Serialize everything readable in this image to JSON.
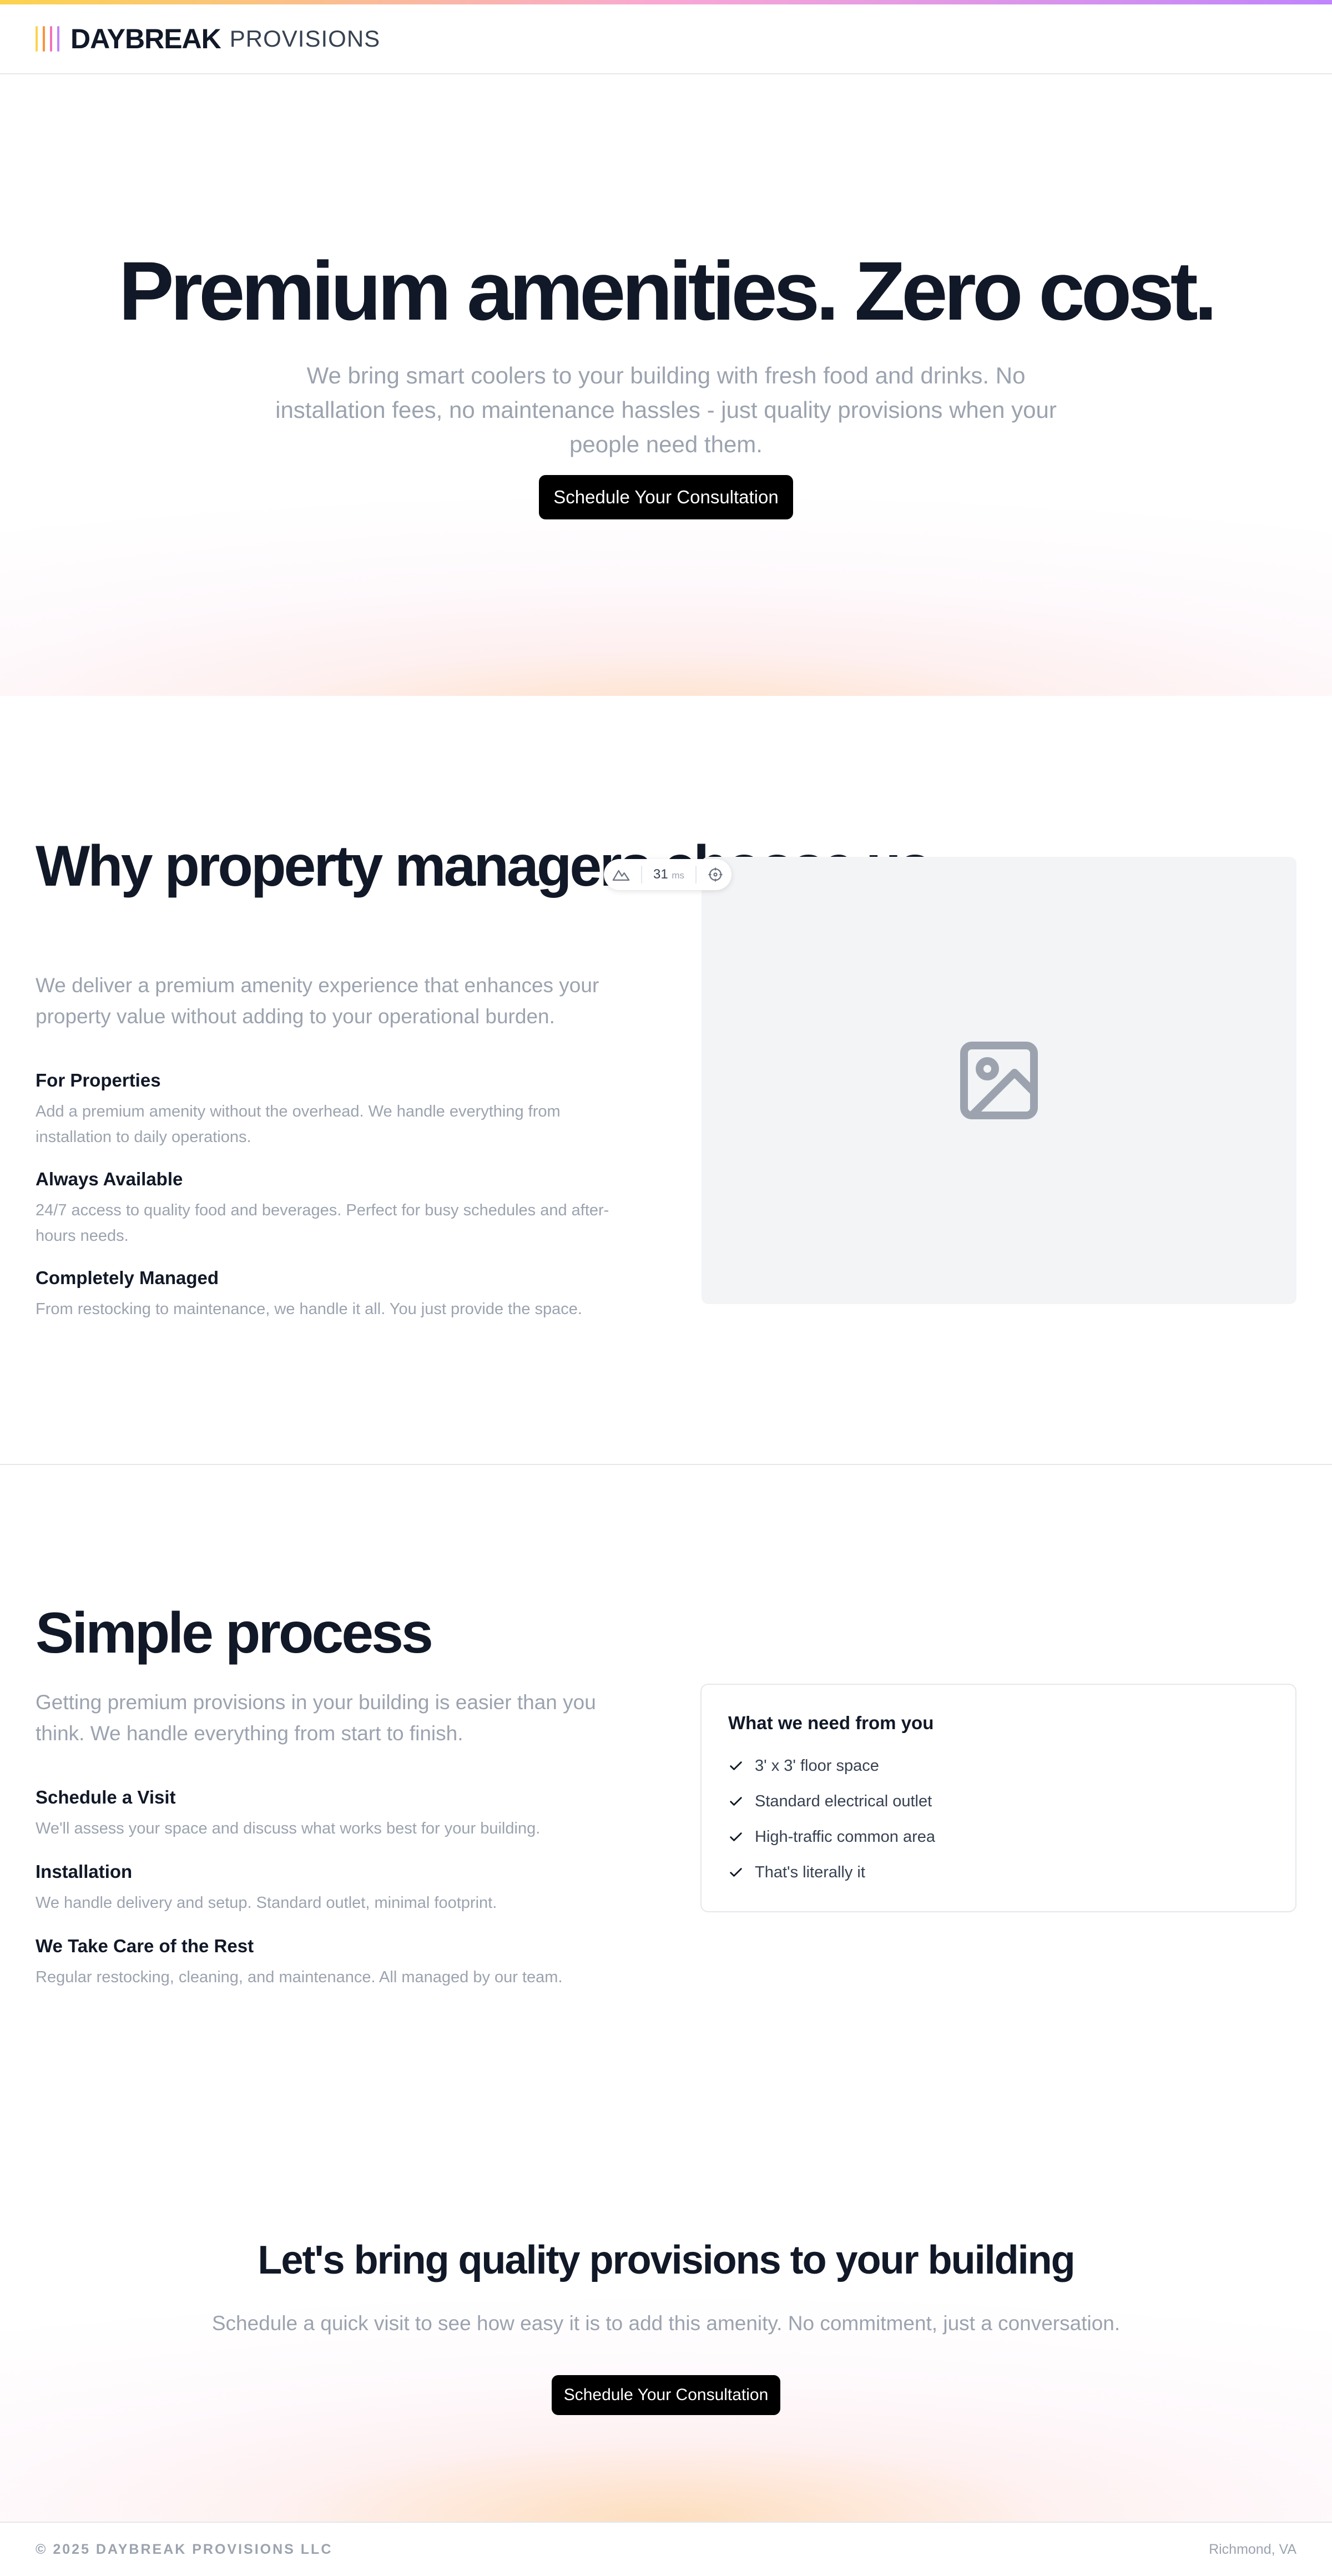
{
  "colors": {
    "accent_bars": [
      "#fcd34d",
      "#fb923c",
      "#f472b6",
      "#c084fc"
    ],
    "button_bg": "#000000",
    "muted_text": "#9ca3af",
    "heading_text": "#111827"
  },
  "brand": {
    "name": "DAYBREAK",
    "sub": "PROVISIONS"
  },
  "hero": {
    "title": "Premium amenities. Zero cost.",
    "subtitle": "We bring smart coolers to your building with fresh food and drinks. No installation fees, no maintenance hassles - just quality provisions when your people need them.",
    "cta_label": "Schedule Your Consultation"
  },
  "why": {
    "title": "Why property managers choose us",
    "lead": "We deliver a premium amenity experience that enhances your property value without adding to your operational burden.",
    "features": [
      {
        "title": "For Properties",
        "text": "Add a premium amenity without the overhead. We handle everything from installation to daily operations."
      },
      {
        "title": "Always Available",
        "text": "24/7 access to quality food and beverages. Perfect for busy schedules and after-hours needs."
      },
      {
        "title": "Completely Managed",
        "text": "From restocking to maintenance, we handle it all. You just provide the space."
      }
    ],
    "image_icon": "image-placeholder-icon"
  },
  "dev_toolbar": {
    "value": "31",
    "unit": "ms",
    "icons": [
      "mountain-icon",
      "crosshair-icon"
    ]
  },
  "process": {
    "title": "Simple process",
    "lead": "Getting premium provisions in your building is easier than you think. We handle everything from start to finish.",
    "steps": [
      {
        "title": "Schedule a Visit",
        "text": "We'll assess your space and discuss what works best for your building."
      },
      {
        "title": "Installation",
        "text": "We handle delivery and setup. Standard outlet, minimal footprint."
      },
      {
        "title": "We Take Care of the Rest",
        "text": "Regular restocking, cleaning, and maintenance. All managed by our team."
      }
    ],
    "requirements": {
      "title": "What we need from you",
      "items": [
        "3' x 3' floor space",
        "Standard electrical outlet",
        "High-traffic common area",
        "That's literally it"
      ]
    }
  },
  "cta": {
    "title": "Let's bring quality provisions to your building",
    "subtitle": "Schedule a quick visit to see how easy it is to add this amenity. No commitment, just a conversation.",
    "button_label": "Schedule Your Consultation"
  },
  "footer": {
    "copyright": "© 2025 DAYBREAK PROVISIONS LLC",
    "location": "Richmond, VA"
  }
}
